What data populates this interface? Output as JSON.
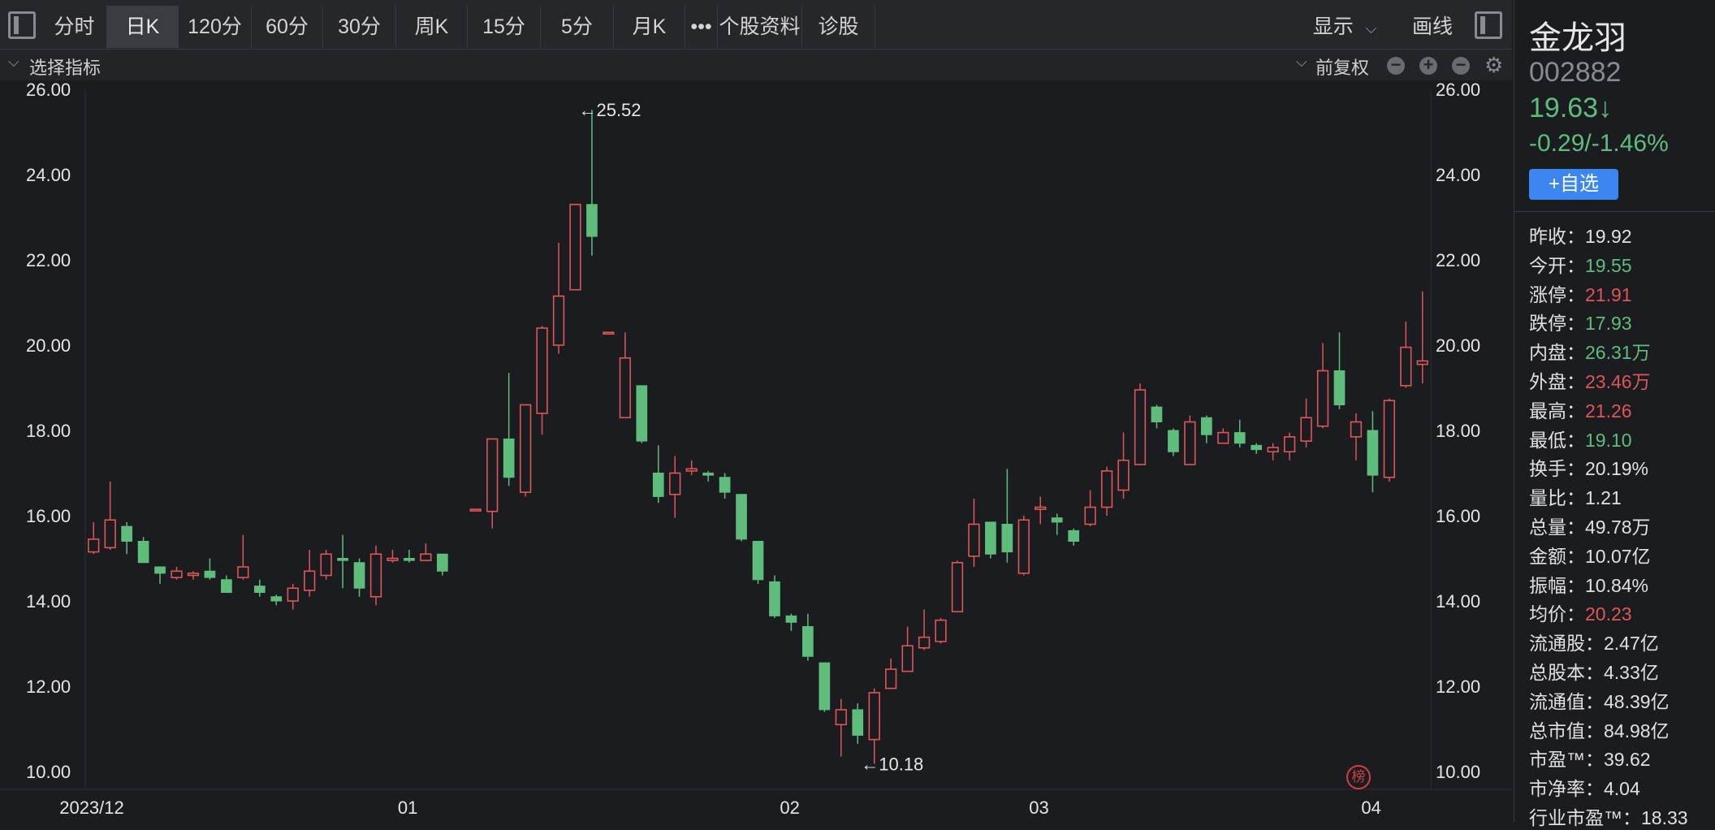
{
  "toolbar": {
    "tabs": [
      "分时",
      "日K",
      "120分",
      "60分",
      "30分",
      "周K",
      "15分",
      "5分",
      "月K",
      "•••",
      "个股资料",
      "诊股"
    ],
    "active_tab": "日K",
    "display_label": "显示",
    "draw_label": "画线"
  },
  "indicator_bar": {
    "select_label": "选择指标",
    "adjust_label": "前复权"
  },
  "stock": {
    "name": "金龙羽",
    "code": "002882",
    "price": "19.63↓",
    "change": "-0.29/-1.46%",
    "watch_button": "+自选"
  },
  "quotes": [
    {
      "label": "昨收：",
      "value": "19.92",
      "color": "white"
    },
    {
      "label": "今开：",
      "value": "19.55",
      "color": "green"
    },
    {
      "label": "涨停：",
      "value": "21.91",
      "color": "red"
    },
    {
      "label": "跌停：",
      "value": "17.93",
      "color": "green"
    },
    {
      "label": "内盘：",
      "value": "26.31万",
      "color": "green"
    },
    {
      "label": "外盘：",
      "value": "23.46万",
      "color": "red"
    },
    {
      "label": "最高：",
      "value": "21.26",
      "color": "red"
    },
    {
      "label": "最低：",
      "value": "19.10",
      "color": "green"
    },
    {
      "label": "换手：",
      "value": "20.19%",
      "color": "white"
    },
    {
      "label": "量比：",
      "value": "1.21",
      "color": "white"
    },
    {
      "label": "总量：",
      "value": "49.78万",
      "color": "white"
    },
    {
      "label": "金额：",
      "value": "10.07亿",
      "color": "white"
    },
    {
      "label": "振幅：",
      "value": "10.84%",
      "color": "white"
    },
    {
      "label": "均价：",
      "value": "20.23",
      "color": "red"
    },
    {
      "label": "流通股：",
      "value": "2.47亿",
      "color": "white"
    },
    {
      "label": "总股本：",
      "value": "4.33亿",
      "color": "white"
    },
    {
      "label": "流通值：",
      "value": "48.39亿",
      "color": "white"
    },
    {
      "label": "总市值：",
      "value": "84.98亿",
      "color": "white"
    },
    {
      "label": "市盈™：",
      "value": "39.62",
      "color": "white"
    },
    {
      "label": "市净率：",
      "value": "4.04",
      "color": "white"
    },
    {
      "label": "行业市盈™：",
      "value": "18.33",
      "color": "white"
    }
  ],
  "seal_text": "榜",
  "chart_data": {
    "type": "candlestick",
    "ylim": [
      10,
      26
    ],
    "y_ticks": [
      "26.00",
      "24.00",
      "22.00",
      "20.00",
      "18.00",
      "16.00",
      "14.00",
      "12.00",
      "10.00"
    ],
    "x_tick_labels": [
      {
        "label": "2023/12",
        "index": 0
      },
      {
        "label": "01",
        "index": 19
      },
      {
        "label": "02",
        "index": 42
      },
      {
        "label": "03",
        "index": 57
      },
      {
        "label": "04",
        "index": 77
      }
    ],
    "annotations": [
      {
        "text": "←25.52",
        "index": 29,
        "value": 25.52
      },
      {
        "text": "←10.18",
        "index": 46,
        "value": 10.18
      }
    ],
    "up_color": "#e05555",
    "down_color": "#5fbd7c",
    "candles": [
      [
        15.15,
        15.45,
        15.85,
        15.1
      ],
      [
        15.25,
        15.9,
        16.8,
        15.2
      ],
      [
        15.75,
        15.4,
        15.85,
        15.1
      ],
      [
        15.4,
        14.9,
        15.5,
        14.9
      ],
      [
        14.8,
        14.65,
        14.8,
        14.4
      ],
      [
        14.55,
        14.7,
        14.8,
        14.5
      ],
      [
        14.6,
        14.65,
        14.7,
        14.5
      ],
      [
        14.7,
        14.55,
        15.0,
        14.5
      ],
      [
        14.5,
        14.2,
        14.6,
        14.2
      ],
      [
        14.55,
        14.8,
        15.55,
        14.5
      ],
      [
        14.35,
        14.2,
        14.5,
        14.1
      ],
      [
        14.1,
        14.0,
        14.15,
        13.9
      ],
      [
        14.0,
        14.3,
        14.4,
        13.8
      ],
      [
        14.25,
        14.7,
        15.2,
        14.1
      ],
      [
        14.6,
        15.1,
        15.2,
        14.5
      ],
      [
        15.0,
        14.95,
        15.55,
        14.3
      ],
      [
        14.9,
        14.3,
        15.0,
        14.1
      ],
      [
        14.1,
        15.1,
        15.3,
        13.9
      ],
      [
        14.95,
        15.0,
        15.2,
        14.9
      ],
      [
        15.0,
        14.95,
        15.2,
        14.9
      ],
      [
        14.95,
        15.1,
        15.35,
        14.95
      ],
      [
        15.1,
        14.7,
        15.1,
        14.6
      ],
      null,
      [
        16.12,
        16.15,
        16.15,
        16.1
      ],
      [
        16.1,
        17.8,
        17.8,
        15.7
      ],
      [
        17.8,
        16.9,
        19.35,
        16.7
      ],
      [
        16.55,
        18.6,
        18.6,
        16.45
      ],
      [
        18.4,
        20.4,
        20.45,
        17.9
      ],
      [
        20.0,
        21.15,
        22.4,
        19.8
      ],
      [
        21.3,
        23.3,
        23.3,
        21.5
      ],
      [
        23.3,
        22.55,
        25.52,
        22.1
      ],
      [
        20.3,
        20.3,
        20.3,
        20.3
      ],
      [
        18.3,
        19.7,
        20.3,
        18.3
      ],
      [
        19.05,
        17.75,
        19.05,
        17.7
      ],
      [
        17.0,
        16.45,
        17.65,
        16.3
      ],
      [
        16.5,
        17.0,
        17.4,
        15.95
      ],
      [
        17.05,
        17.1,
        17.3,
        16.95
      ],
      [
        17.0,
        16.95,
        17.05,
        16.8
      ],
      [
        16.9,
        16.55,
        17.0,
        16.4
      ],
      [
        16.5,
        15.45,
        16.5,
        15.4
      ],
      [
        15.4,
        14.5,
        15.4,
        14.4
      ],
      [
        14.45,
        13.65,
        14.6,
        13.6
      ],
      [
        13.65,
        13.5,
        13.7,
        13.3
      ],
      [
        13.4,
        12.7,
        13.7,
        12.6
      ],
      [
        12.55,
        11.45,
        12.55,
        11.4
      ],
      [
        11.1,
        11.45,
        11.7,
        10.35
      ],
      [
        11.45,
        10.85,
        11.6,
        10.65
      ],
      [
        10.75,
        11.85,
        11.95,
        10.18
      ],
      [
        11.95,
        12.4,
        12.65,
        11.95
      ],
      [
        12.35,
        12.95,
        13.4,
        12.35
      ],
      [
        12.9,
        13.15,
        13.8,
        12.85
      ],
      [
        13.05,
        13.55,
        13.6,
        13.0
      ],
      [
        13.75,
        14.9,
        14.95,
        13.75
      ],
      [
        15.05,
        15.8,
        16.4,
        14.8
      ],
      [
        15.85,
        15.1,
        15.85,
        15.0
      ],
      [
        15.8,
        15.15,
        17.1,
        14.9
      ],
      [
        14.65,
        15.9,
        16.0,
        14.6
      ],
      [
        16.15,
        16.2,
        16.45,
        15.8
      ],
      [
        15.95,
        15.85,
        16.05,
        15.55
      ],
      [
        15.65,
        15.4,
        15.7,
        15.3
      ],
      [
        15.8,
        16.2,
        16.6,
        15.75
      ],
      [
        16.2,
        17.05,
        17.15,
        16.0
      ],
      [
        16.6,
        17.3,
        17.95,
        16.4
      ],
      [
        17.2,
        18.95,
        19.1,
        17.2
      ],
      [
        18.55,
        18.2,
        18.6,
        18.05
      ],
      [
        18.0,
        17.5,
        18.05,
        17.4
      ],
      [
        17.2,
        18.2,
        18.35,
        17.2
      ],
      [
        18.3,
        17.9,
        18.35,
        17.7
      ],
      [
        17.7,
        17.95,
        18.05,
        17.7
      ],
      [
        17.95,
        17.7,
        18.25,
        17.6
      ],
      [
        17.65,
        17.55,
        17.7,
        17.45
      ],
      [
        17.5,
        17.6,
        17.7,
        17.3
      ],
      [
        17.5,
        17.85,
        17.95,
        17.3
      ],
      [
        17.75,
        18.3,
        18.75,
        17.6
      ],
      [
        18.1,
        19.4,
        20.05,
        18.05
      ],
      [
        19.4,
        18.6,
        20.3,
        18.5
      ],
      [
        17.85,
        18.2,
        18.4,
        17.3
      ],
      [
        18.0,
        16.95,
        18.45,
        16.55
      ],
      [
        16.9,
        18.7,
        18.75,
        16.8
      ],
      [
        19.05,
        19.95,
        20.55,
        19.0
      ],
      [
        19.55,
        19.63,
        21.26,
        19.1
      ]
    ]
  }
}
